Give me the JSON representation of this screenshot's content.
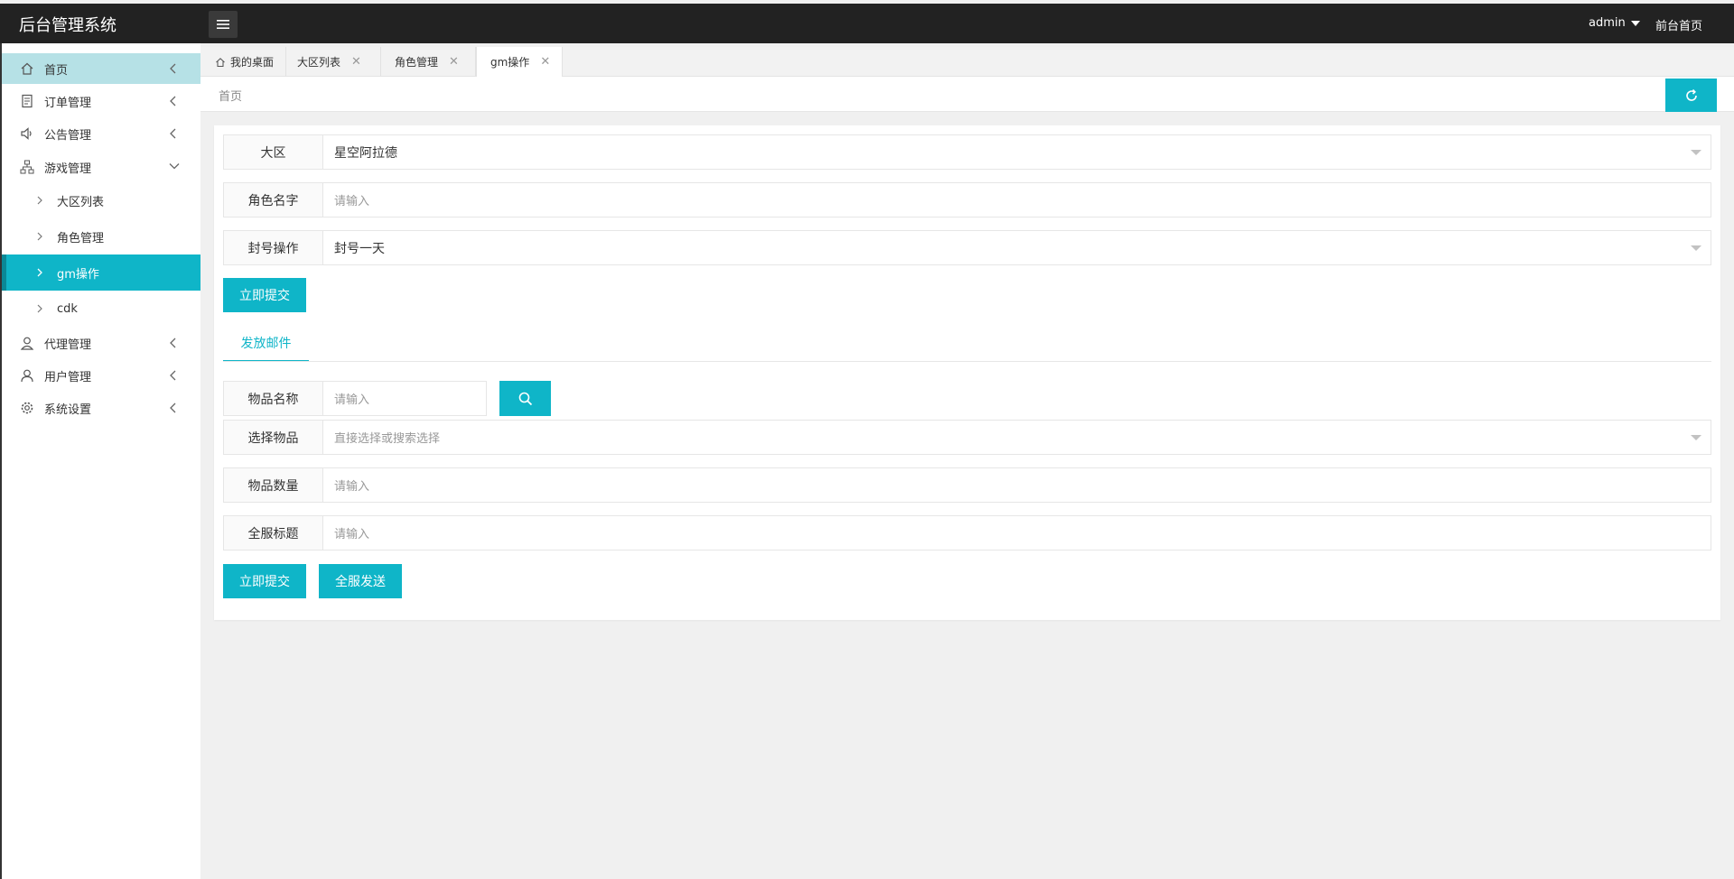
{
  "header": {
    "title": "后台管理系统",
    "user": "admin",
    "front_link": "前台首页"
  },
  "sidebar": {
    "items": [
      {
        "label": "首页",
        "icon": "home-icon"
      },
      {
        "label": "订单管理",
        "icon": "order-icon"
      },
      {
        "label": "公告管理",
        "icon": "speaker-icon"
      },
      {
        "label": "游戏管理",
        "icon": "sitemap-icon"
      },
      {
        "label": "代理管理",
        "icon": "agent-icon"
      },
      {
        "label": "用户管理",
        "icon": "user-icon"
      },
      {
        "label": "系统设置",
        "icon": "gear-icon"
      }
    ],
    "sub_items": [
      {
        "label": "大区列表"
      },
      {
        "label": "角色管理"
      },
      {
        "label": "gm操作"
      },
      {
        "label": "cdk"
      }
    ]
  },
  "tabs": [
    {
      "label": "我的桌面"
    },
    {
      "label": "大区列表"
    },
    {
      "label": "角色管理"
    },
    {
      "label": "gm操作"
    }
  ],
  "breadcrumb": "首页",
  "form": {
    "region_label": "大区",
    "region_value": "星空阿拉德",
    "role_label": "角色名字",
    "role_placeholder": "请输入",
    "ban_label": "封号操作",
    "ban_value": "封号一天",
    "submit1": "立即提交"
  },
  "mail": {
    "tab_label": "发放邮件",
    "item_name_label": "物品名称",
    "item_name_placeholder": "请输入",
    "select_item_label": "选择物品",
    "select_item_placeholder": "直接选择或搜索选择",
    "item_count_label": "物品数量",
    "item_count_placeholder": "请输入",
    "server_title_label": "全服标题",
    "server_title_placeholder": "请输入",
    "submit2": "立即提交",
    "broadcast": "全服发送"
  },
  "colors": {
    "accent": "#0fb5c8",
    "topbar": "#222222",
    "home_highlight": "#b6e1e6"
  }
}
